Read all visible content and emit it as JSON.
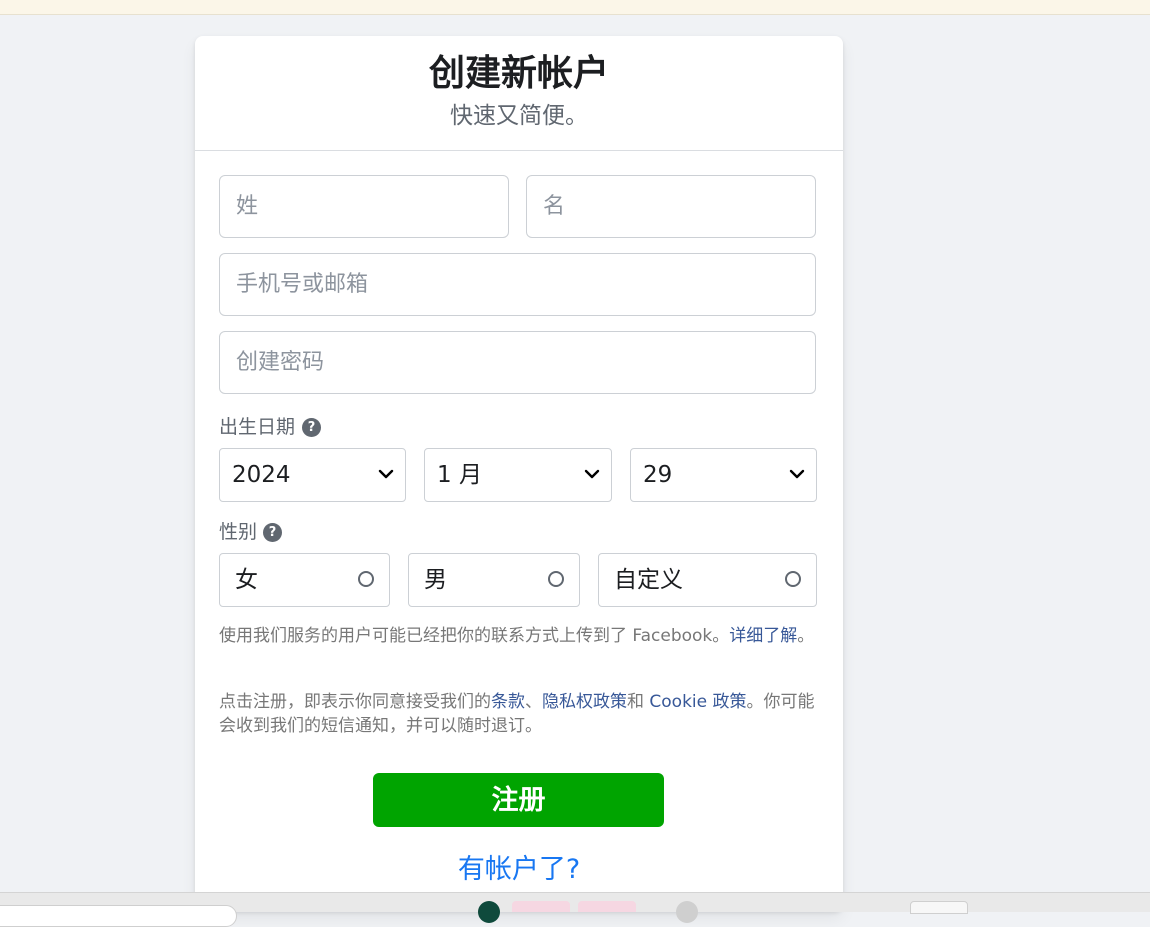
{
  "header": {
    "title": "创建新帐户",
    "subtitle": "快速又简便。"
  },
  "form": {
    "last_name_placeholder": "姓",
    "first_name_placeholder": "名",
    "contact_placeholder": "手机号或邮箱",
    "password_placeholder": "创建密码"
  },
  "birthday": {
    "label": "出生日期",
    "help_icon": "question-circle-icon",
    "year": "2024",
    "month": "1 月",
    "day": "29"
  },
  "gender": {
    "label": "性别",
    "help_icon": "question-circle-icon",
    "options": [
      "女",
      "男",
      "自定义"
    ]
  },
  "notices": {
    "contact_upload_text": "使用我们服务的用户可能已经把你的联系方式上传到了 Facebook。",
    "learn_more_link": "详细了解",
    "learn_more_suffix": "。",
    "terms_prefix": "点击注册，即表示你同意接受我们的",
    "terms_link": "条款",
    "sep1": "、",
    "privacy_link": "隐私权政策",
    "and": "和 ",
    "cookie_link": "Cookie 政策",
    "terms_suffix": "。你可能会收到我们的短信通知，并可以随时退订。"
  },
  "actions": {
    "signup_label": "注册",
    "have_account_label": "有帐户了?"
  },
  "colors": {
    "signup_green": "#00a400",
    "link_blue": "#385898",
    "accent_blue": "#1877f2",
    "page_bg": "#f0f2f5"
  }
}
